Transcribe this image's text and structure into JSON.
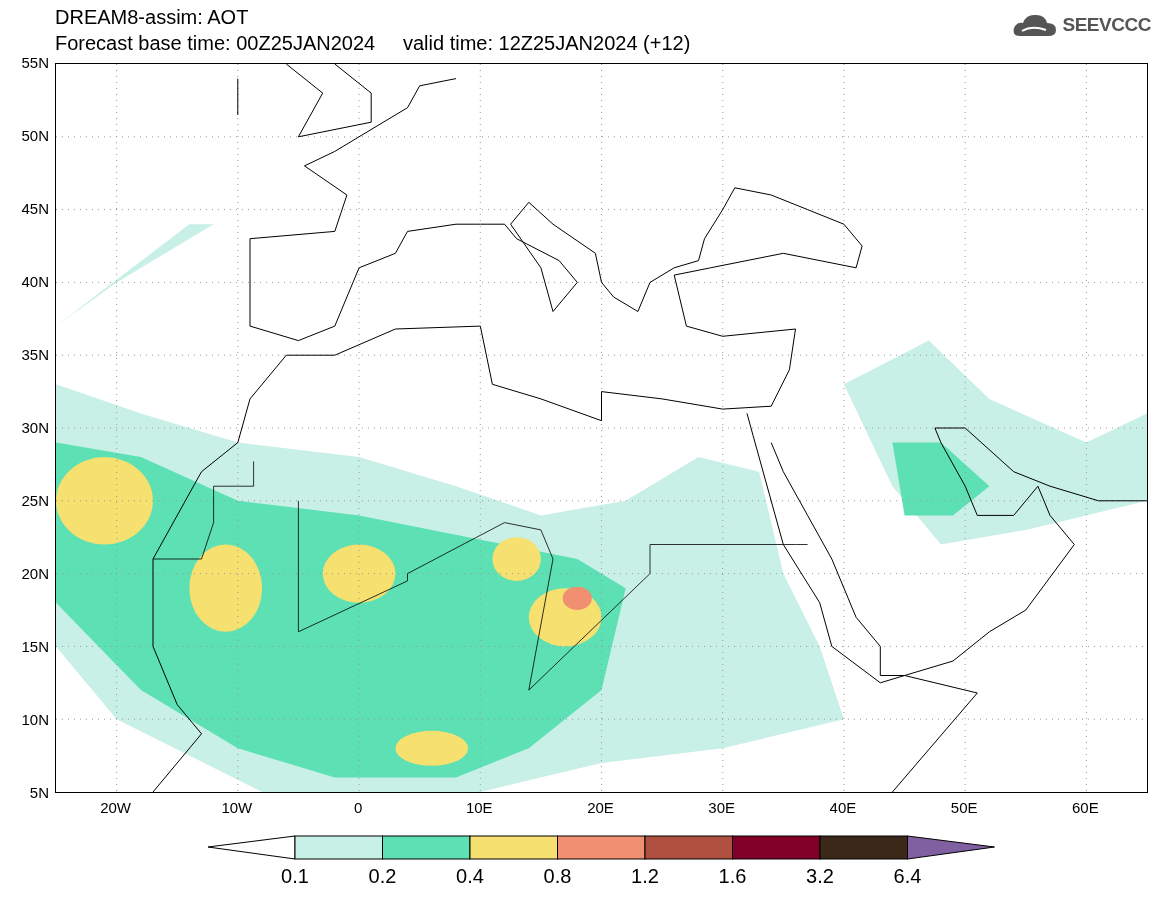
{
  "title_lines": [
    "DREAM8-assim: AOT",
    "Forecast base time: 00Z25JAN2024     valid time: 12Z25JAN2024 (+12)"
  ],
  "logo": {
    "text": "SEEVCCC"
  },
  "lat_labels": [
    "55N",
    "50N",
    "45N",
    "40N",
    "35N",
    "30N",
    "25N",
    "20N",
    "15N",
    "10N",
    "5N"
  ],
  "lon_labels": [
    "20W",
    "10W",
    "0",
    "10E",
    "20E",
    "30E",
    "40E",
    "50E",
    "60E"
  ],
  "colorbar": {
    "bins": [
      {
        "kind": "low",
        "color": "#ffffff"
      },
      {
        "kind": "box",
        "color": "#c8f0e6"
      },
      {
        "kind": "box",
        "color": "#5ce0b4"
      },
      {
        "kind": "box",
        "color": "#f5e070"
      },
      {
        "kind": "box",
        "color": "#f09070"
      },
      {
        "kind": "box",
        "color": "#b05040"
      },
      {
        "kind": "box",
        "color": "#800028"
      },
      {
        "kind": "box",
        "color": "#3c2818"
      },
      {
        "kind": "high",
        "color": "#8060a0"
      }
    ],
    "labels": [
      "0.1",
      "0.2",
      "0.4",
      "0.8",
      "1.2",
      "1.6",
      "3.2",
      "6.4"
    ]
  }
}
